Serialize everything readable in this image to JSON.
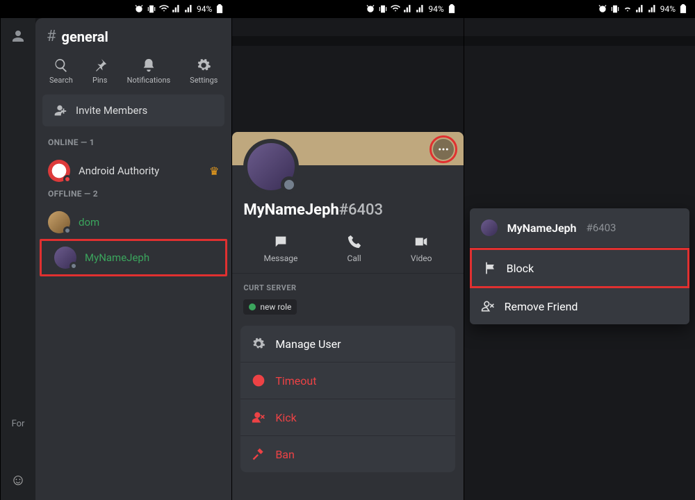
{
  "status": {
    "battery": "94%"
  },
  "channel": {
    "name": "general"
  },
  "toolbar": {
    "search": "Search",
    "pins": "Pins",
    "notifications": "Notifications",
    "settings": "Settings"
  },
  "invite": "Invite Members",
  "sections": {
    "online": "ONLINE — 1",
    "offline": "OFFLINE — 2"
  },
  "members": {
    "aa": "Android Authority",
    "dom": "dom",
    "jeph": "MyNameJeph"
  },
  "leftRail": {
    "for": "For"
  },
  "profile": {
    "name": "MyNameJeph",
    "disc": "#6403",
    "actions": {
      "message": "Message",
      "call": "Call",
      "video": "Video"
    },
    "server_label": "CURT SERVER",
    "role": "new role",
    "options": {
      "manage": "Manage User",
      "timeout": "Timeout",
      "kick": "Kick",
      "ban": "Ban"
    }
  },
  "popup": {
    "name": "MyNameJeph",
    "disc": "#6403",
    "block": "Block",
    "remove": "Remove Friend"
  }
}
